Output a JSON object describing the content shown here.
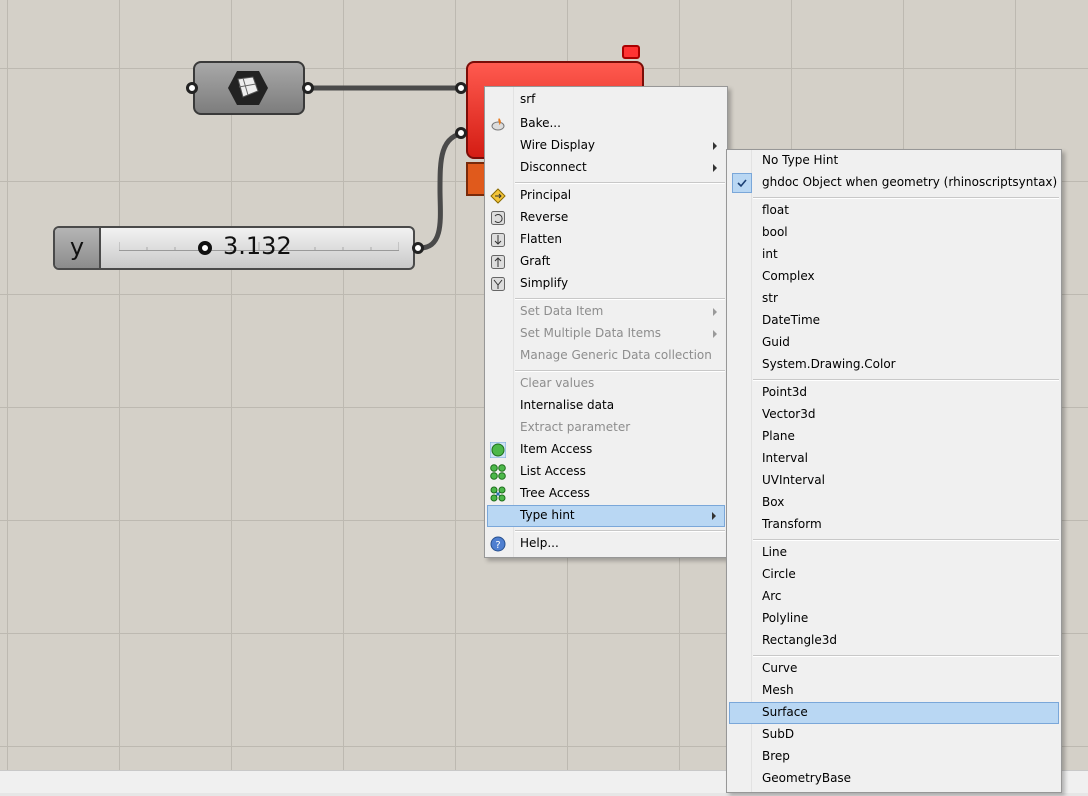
{
  "slider": {
    "tag": "y",
    "value": "3.132"
  },
  "context_menu": {
    "title": "srf",
    "items": [
      {
        "label": "Bake...",
        "icon": "bake-icon"
      },
      {
        "label": "Wire Display",
        "submenu": true
      },
      {
        "label": "Disconnect",
        "submenu": true
      },
      {
        "label": "Principal",
        "icon": "principal-icon"
      },
      {
        "label": "Reverse",
        "icon": "reverse-icon"
      },
      {
        "label": "Flatten",
        "icon": "flatten-icon"
      },
      {
        "label": "Graft",
        "icon": "graft-icon"
      },
      {
        "label": "Simplify",
        "icon": "simplify-icon"
      },
      {
        "label": "Set Data Item",
        "disabled": true,
        "submenu": true
      },
      {
        "label": "Set Multiple Data Items",
        "disabled": true,
        "submenu": true
      },
      {
        "label": "Manage Generic Data collection",
        "disabled": true
      },
      {
        "label": "Clear values",
        "disabled": true
      },
      {
        "label": "Internalise data"
      },
      {
        "label": "Extract parameter",
        "disabled": true
      },
      {
        "label": "Item Access",
        "icon": "item-access-icon"
      },
      {
        "label": "List Access",
        "icon": "list-access-icon"
      },
      {
        "label": "Tree Access",
        "icon": "tree-access-icon"
      },
      {
        "label": "Type hint",
        "submenu": true,
        "highlighted": true
      },
      {
        "label": "Help...",
        "icon": "help-icon"
      }
    ]
  },
  "type_hint_menu": {
    "items": [
      "No Type Hint",
      "ghdoc Object when geometry (rhinoscriptsyntax)",
      "float",
      "bool",
      "int",
      "Complex",
      "str",
      "DateTime",
      "Guid",
      "System.Drawing.Color",
      "Point3d",
      "Vector3d",
      "Plane",
      "Interval",
      "UVInterval",
      "Box",
      "Transform",
      "Line",
      "Circle",
      "Arc",
      "Polyline",
      "Rectangle3d",
      "Curve",
      "Mesh",
      "Surface",
      "SubD",
      "Brep",
      "GeometryBase"
    ],
    "checked": "ghdoc Object when geometry (rhinoscriptsyntax)",
    "highlighted": "Surface"
  },
  "colors": {
    "highlight": "#b9d7f3",
    "component_red": "#e0281d",
    "canvas": "#d4d0c8"
  }
}
